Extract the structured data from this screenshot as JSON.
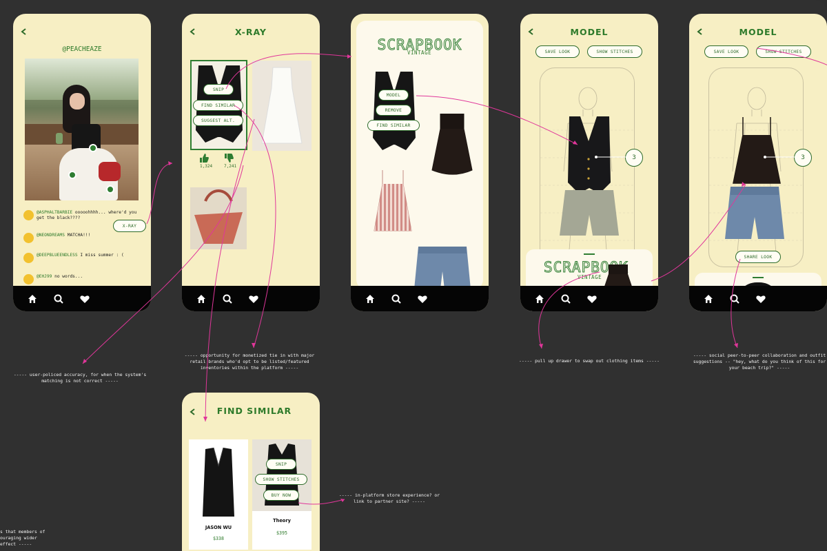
{
  "screens": {
    "feed": {
      "username": "@PEACHEAZE",
      "xray_button": "X-RAY",
      "comments": [
        {
          "handle": "@ASPHALTBARBIE",
          "text": "ooooohhhh... where'd you get the black????"
        },
        {
          "handle": "@NEONDREAMS",
          "text": "MATCHA!!!"
        },
        {
          "handle": "@DEEPBLUEENDLESS",
          "text": "I miss summer : ("
        },
        {
          "handle": "@EHJ99",
          "text": "no words..."
        }
      ]
    },
    "xray": {
      "title": "X-RAY",
      "snip": "SNIP",
      "find_similar": "FIND SIMILAR",
      "suggest_alt": "SUGGEST ALT.",
      "likes": "1,324",
      "dislikes": "7,241"
    },
    "scrapbook": {
      "title": "SCRAPBOOK",
      "subtitle": "VINTAGE",
      "model": "MODEL",
      "remove": "REMOVE",
      "find_similar": "FIND SIMILAR"
    },
    "model1": {
      "title": "MODEL",
      "save_look": "SAVE LOOK",
      "show_stitches": "SHOW STITCHES",
      "stitch_count": "3",
      "drawer_title": "SCRAPBOOK",
      "drawer_subtitle": "VINTAGE"
    },
    "model2": {
      "title": "MODEL",
      "save_look": "SAVE LOOK",
      "show_stitches": "SHOW STITCHES",
      "stitch_count": "3",
      "share_look": "SHARE LOOK"
    },
    "find_similar": {
      "title": "FIND SIMILAR",
      "snip": "SNIP",
      "show_stitches": "SHOW STITCHES",
      "buy_now": "BUY NOW",
      "products": [
        {
          "brand": "JASON WU",
          "price": "$338"
        },
        {
          "brand": "Theory",
          "price": "$395"
        }
      ]
    }
  },
  "annotations": {
    "user_policed": "----- user-policed accuracy, for when the system's matching is not correct -----",
    "monetized": "----- opportunity for monetized tie in with major retail brands who'd opt to be listed/featured inventories within the platform -----",
    "drawer": "----- pull up drawer to swap out clothing items -----",
    "social": "----- social peer-to-peer collaboration and outfit suggestions -- \"hey, what do you think of this for your beach trip?\" -----",
    "store": "----- in-platform store experience? or link to partner site? -----",
    "cut_1": "s that members of",
    "cut_2": "ouraging wider",
    "cut_3": "effect -----"
  },
  "colors": {
    "phone_bg": "#f7efc4",
    "accent_green": "#2d7a2a",
    "annotation_pink": "#e0369a",
    "canvas": "#303030"
  },
  "icons": [
    "back-arrow-icon",
    "home-icon",
    "search-icon",
    "heart-icon",
    "thumbs-up-icon",
    "thumbs-down-icon"
  ]
}
